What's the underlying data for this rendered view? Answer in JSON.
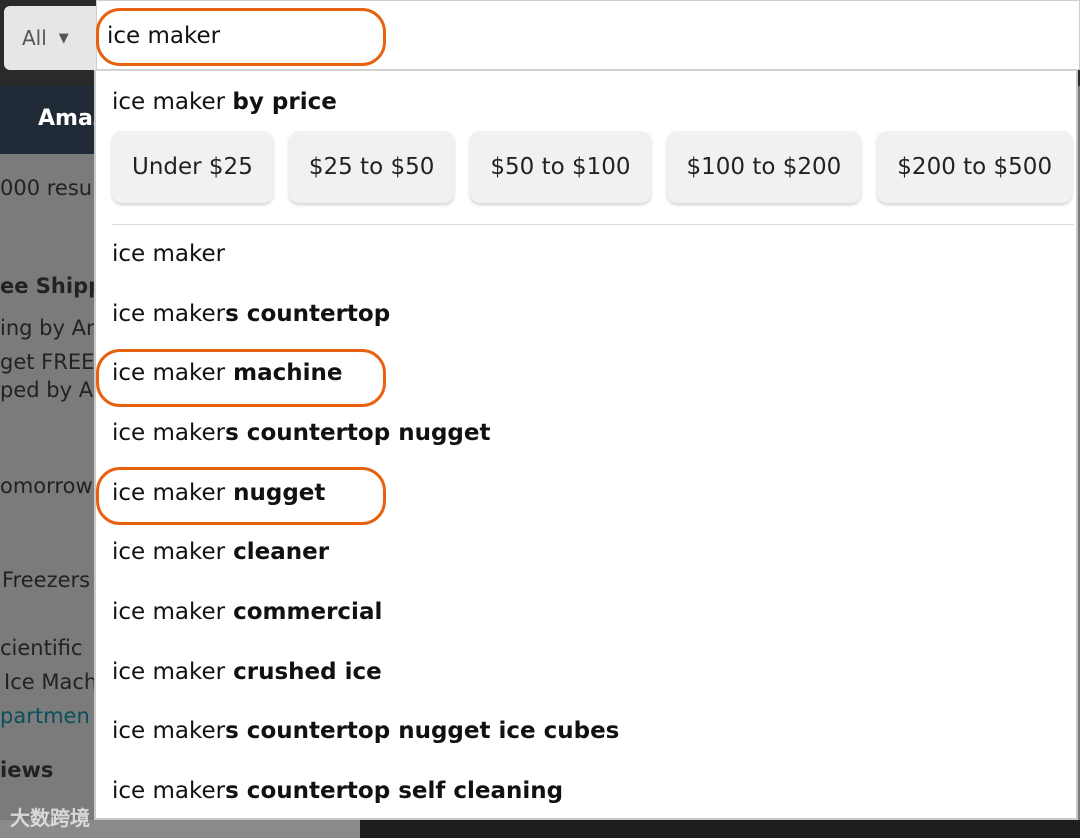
{
  "scope_select": {
    "label": "All"
  },
  "search": {
    "value": "ice maker"
  },
  "background": {
    "nav_label": "Amaz",
    "results_text": "000 resu",
    "left_lines": [
      {
        "text": "ee Shipp",
        "bold": true
      },
      {
        "text": "ing by Ar",
        "bold": false
      },
      {
        "text": "get FREE",
        "bold": false
      },
      {
        "text": "ped by A",
        "bold": false
      },
      {
        "text": "omorrow",
        "bold": false
      },
      {
        "text": "Freezers",
        "bold": false
      },
      {
        "text": "cientific",
        "bold": false
      },
      {
        "text": "Ice Mach",
        "bold": false
      },
      {
        "text": "partmen",
        "bold": false
      },
      {
        "text": "iews",
        "bold": true
      }
    ],
    "watermark": "大数跨境"
  },
  "price_section": {
    "prefix": "ice maker",
    "suffix": "by price",
    "chips": [
      "Under $25",
      "$25 to $50",
      "$50 to $100",
      "$100 to $200",
      "$200 to $500"
    ]
  },
  "suggestions": [
    {
      "prefix": "ice maker",
      "suffix": ""
    },
    {
      "prefix": "ice maker",
      "suffix": "s countertop"
    },
    {
      "prefix": "ice maker",
      "suffix": " machine"
    },
    {
      "prefix": "ice maker",
      "suffix": "s countertop nugget"
    },
    {
      "prefix": "ice maker",
      "suffix": " nugget"
    },
    {
      "prefix": "ice maker",
      "suffix": " cleaner"
    },
    {
      "prefix": "ice maker",
      "suffix": " commercial"
    },
    {
      "prefix": "ice maker",
      "suffix": " crushed ice"
    },
    {
      "prefix": "ice maker",
      "suffix": "s countertop nugget ice cubes"
    },
    {
      "prefix": "ice maker",
      "suffix": "s countertop self cleaning"
    }
  ],
  "colors": {
    "annotation": "#e8610f"
  }
}
